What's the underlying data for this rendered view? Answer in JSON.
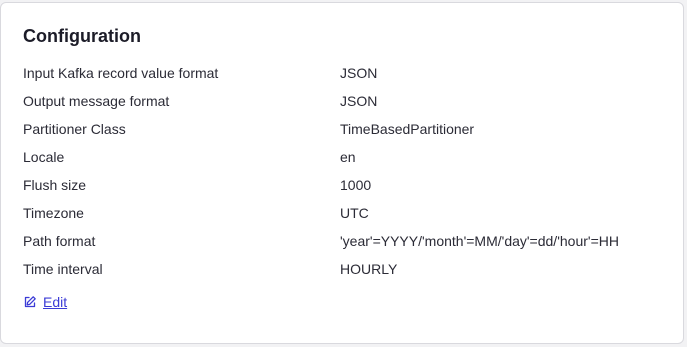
{
  "card": {
    "title": "Configuration",
    "rows": [
      {
        "label": "Input Kafka record value format",
        "value": "JSON"
      },
      {
        "label": "Output message format",
        "value": "JSON"
      },
      {
        "label": "Partitioner Class",
        "value": "TimeBasedPartitioner"
      },
      {
        "label": "Locale",
        "value": "en"
      },
      {
        "label": "Flush size",
        "value": "1000"
      },
      {
        "label": "Timezone",
        "value": "UTC"
      },
      {
        "label": "Path format",
        "value": "'year'=YYYY/'month'=MM/'day'=dd/'hour'=HH"
      },
      {
        "label": "Time interval",
        "value": "HOURLY"
      }
    ],
    "edit_label": "Edit",
    "edit_icon": "edit-icon"
  },
  "colors": {
    "accent": "#3b3bd6",
    "text": "#2b2b36",
    "title": "#1c1c28",
    "border": "#d9d9de",
    "background": "#f2f2f4"
  }
}
